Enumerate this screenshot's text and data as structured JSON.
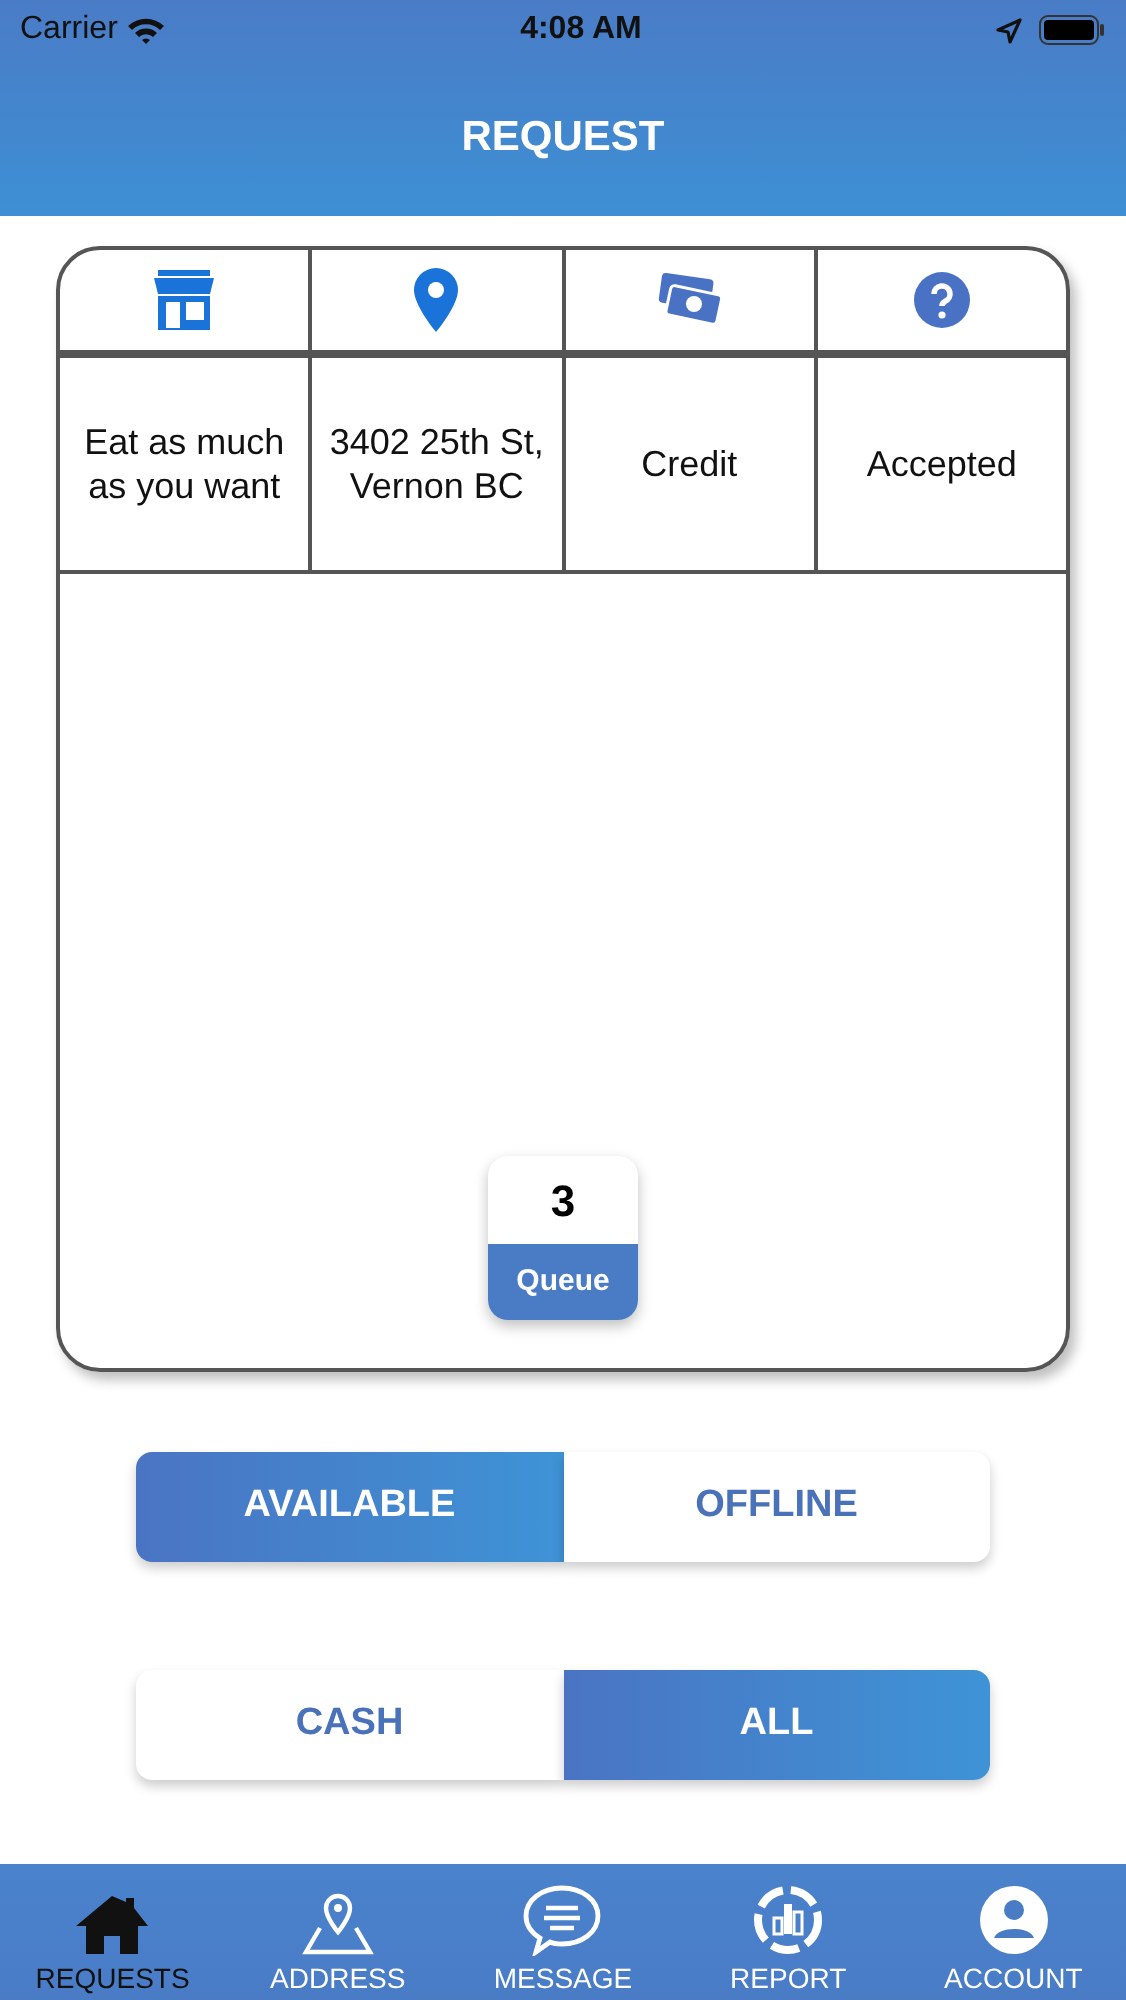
{
  "status_bar": {
    "carrier": "Carrier",
    "time": "4:08 AM"
  },
  "header": {
    "title": "REQUEST"
  },
  "table": {
    "rows": [
      {
        "cells": [
          "Eat as much as you want",
          "3402 25th St, Vernon BC",
          "Credit",
          "Accepted"
        ]
      }
    ]
  },
  "queue": {
    "count": "3",
    "label": "Queue"
  },
  "toggles": [
    {
      "options": [
        {
          "label": "AVAILABLE",
          "selected": true
        },
        {
          "label": "OFFLINE",
          "selected": false
        }
      ]
    },
    {
      "options": [
        {
          "label": "CASH",
          "selected": false
        },
        {
          "label": "ALL",
          "selected": true
        }
      ]
    }
  ],
  "tabs": [
    {
      "label": "REQUESTS",
      "selected": true
    },
    {
      "label": "ADDRESS",
      "selected": false
    },
    {
      "label": "MESSAGE",
      "selected": false
    },
    {
      "label": "REPORT",
      "selected": false
    },
    {
      "label": "ACCOUNT",
      "selected": false
    }
  ]
}
